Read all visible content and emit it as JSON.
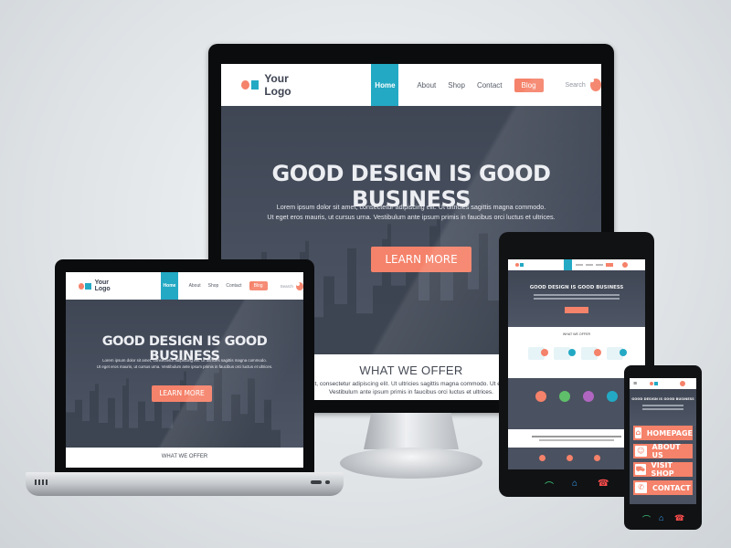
{
  "colors": {
    "accent_blue": "#23a9c4",
    "accent_orange": "#f5826a",
    "hero_dark": "#4a5160"
  },
  "site": {
    "logo_text": "Your Logo",
    "nav": {
      "home": "Home",
      "about": "About",
      "shop": "Shop",
      "contact": "Contact",
      "blog": "Blog"
    },
    "search_label": "Search",
    "hero_title": "GOOD DESIGN IS GOOD BUSINESS",
    "hero_line1": "Lorem ipsum dolor sit amet, consectetur adipiscing elit. Ut ultricies sagittis magna commodo.",
    "hero_line2": "Ut eget eros mauris, ut cursus urna. Vestibulum ante ipsum primis in faucibus orci luctus et ultrices.",
    "cta": "LEARN MORE",
    "offer_title": "WHAT WE OFFER",
    "offer_line1": "amet, consectetur adipiscing elit. Ut ultricies sagittis magna commodo. Ut eget ero",
    "offer_line2": "Vestibulum ante ipsum primis in faucibus orci luctus et ultrices."
  },
  "tablet": {
    "features": [
      "",
      "",
      "",
      ""
    ]
  },
  "phone": {
    "title": "GOOD DESIGN IS GOOD BUSINESS",
    "menu": [
      {
        "label": "HOMEPAGE",
        "icon": "home-icon",
        "glyph": "⌂"
      },
      {
        "label": "ABOUT US",
        "icon": "user-icon",
        "glyph": "☺"
      },
      {
        "label": "VISIT SHOP",
        "icon": "cart-icon",
        "glyph": "⛟"
      },
      {
        "label": "CONTACT",
        "icon": "phone-icon",
        "glyph": "✆"
      }
    ]
  }
}
